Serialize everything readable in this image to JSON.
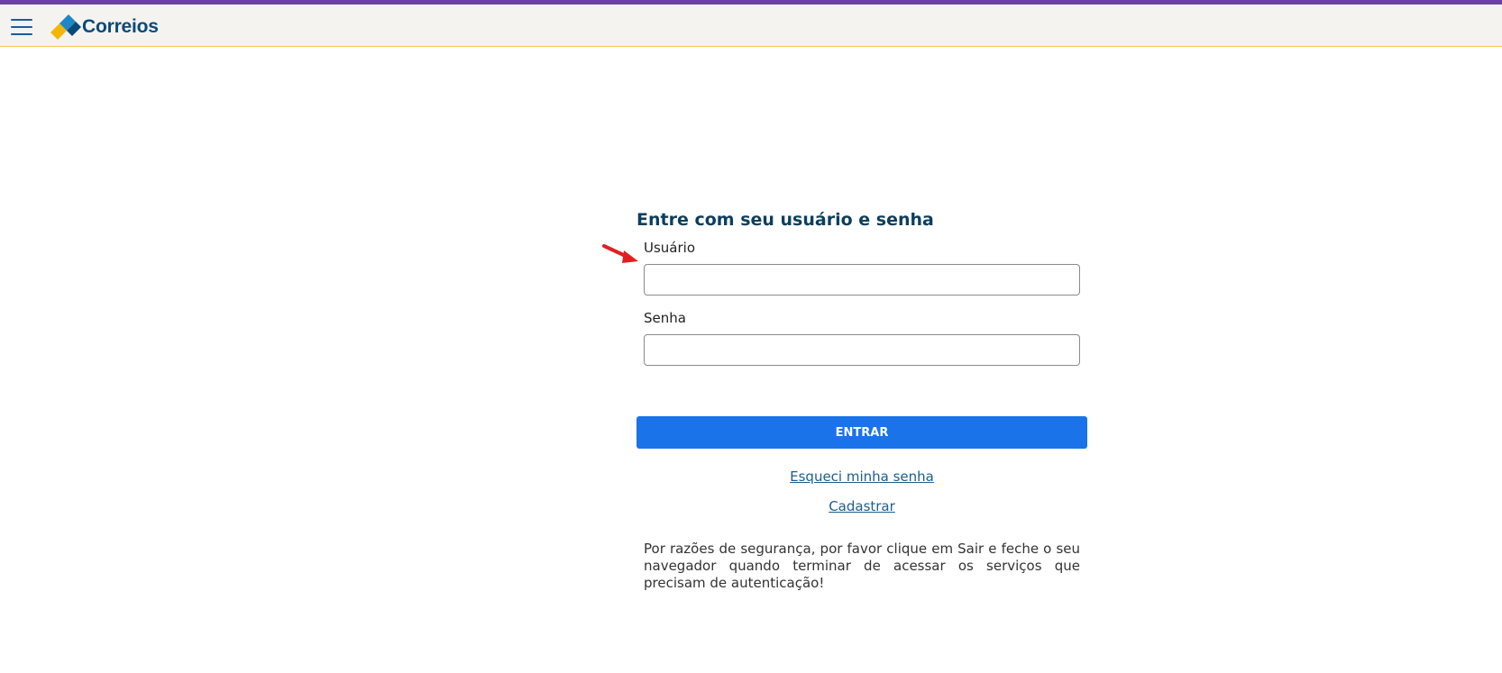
{
  "header": {
    "brand_name": "Correios",
    "accent_color": "#6a3fa8",
    "header_bg": "#f4f3f0"
  },
  "login": {
    "title": "Entre com seu usuário e senha",
    "username_label": "Usuário",
    "username_value": "",
    "password_label": "Senha",
    "password_value": "",
    "submit_label": "ENTRAR",
    "forgot_link": "Esqueci minha senha",
    "register_link": "Cadastrar",
    "security_notice": "Por razões de segurança, por favor clique em Sair e feche o seu navegador quando terminar de acessar os serviços que precisam de autenticação!",
    "button_color": "#1a73e8"
  },
  "icons": {
    "menu": "hamburger-menu-icon",
    "logo": "correios-logo-icon",
    "annotation": "red-arrow-icon"
  }
}
